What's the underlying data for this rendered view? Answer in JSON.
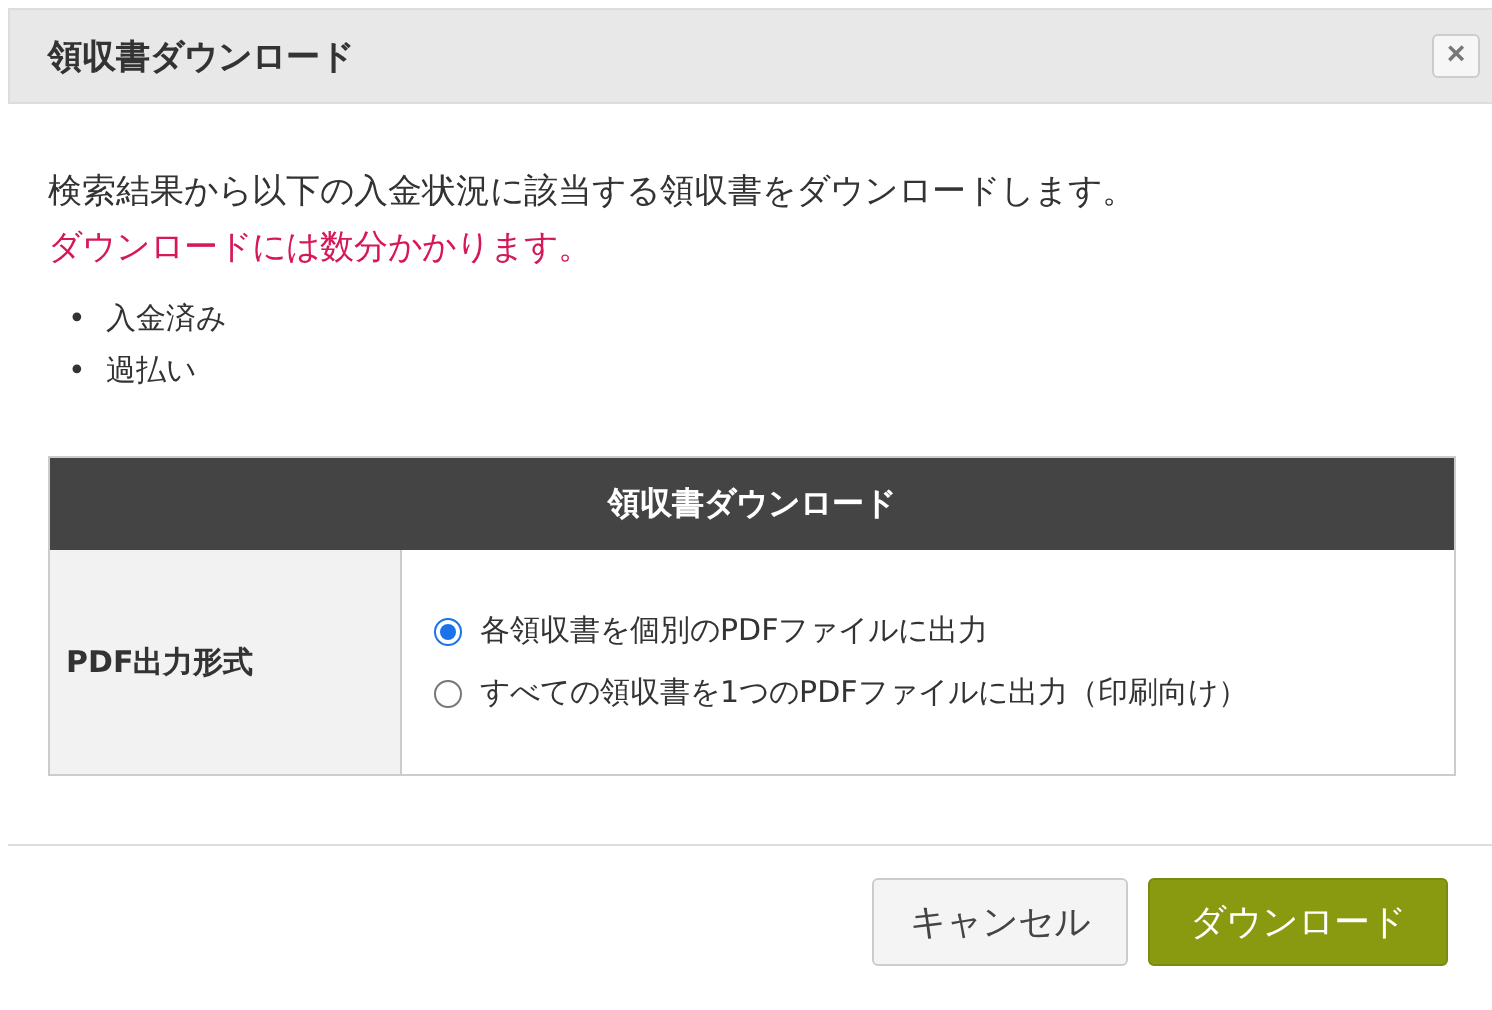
{
  "dialog": {
    "title": "領収書ダウンロード",
    "close_label": "×"
  },
  "message": "検索結果から以下の入金状況に該当する領収書をダウンロードします。",
  "warning": "ダウンロードには数分かかります。",
  "statuses": [
    {
      "bullet": "•",
      "label": "入金済み"
    },
    {
      "bullet": "•",
      "label": "過払い"
    }
  ],
  "table": {
    "heading": "領収書ダウンロード",
    "row_label": "PDF出力形式",
    "options": [
      {
        "label": "各領収書を個別のPDFファイルに出力",
        "selected": true
      },
      {
        "label": "すべての領収書を1つのPDFファイルに出力（印刷向け）",
        "selected": false
      }
    ]
  },
  "buttons": [
    {
      "label": "キャンセル",
      "kind": "secondary"
    },
    {
      "label": "ダウンロード",
      "kind": "primary"
    }
  ]
}
